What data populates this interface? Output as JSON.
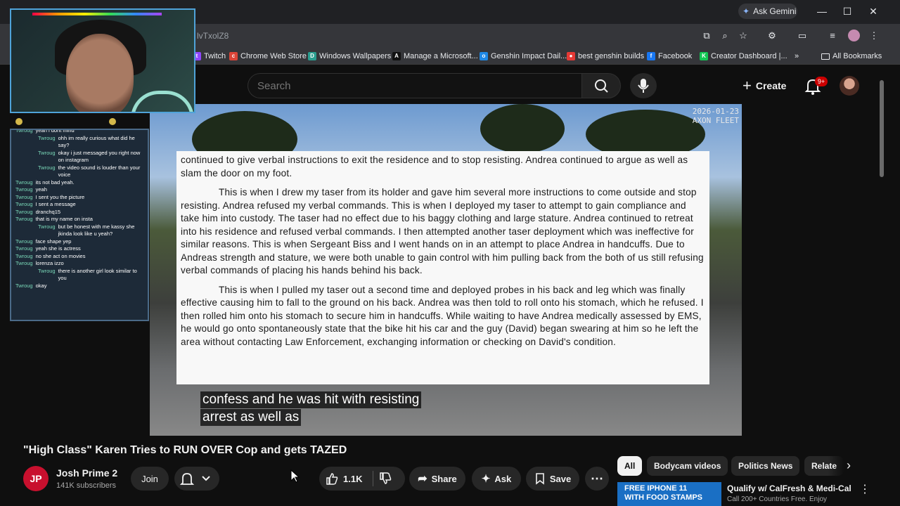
{
  "browser": {
    "ask_gemini": "Ask Gemini",
    "url_fragment": "lvTxolZ8",
    "bookmarks": [
      {
        "label": "Twitch",
        "color": "#9146ff",
        "glyph": "t"
      },
      {
        "label": "Chrome Web Store",
        "color": "#db4437",
        "glyph": "c"
      },
      {
        "label": "Windows Wallpapers",
        "color": "#2a9d8f",
        "glyph": "D"
      },
      {
        "label": "Manage a Microsoft...",
        "color": "#111111",
        "glyph": "A"
      },
      {
        "label": "Genshin Impact Dail...",
        "color": "#1e88e5",
        "glyph": "o"
      },
      {
        "label": "best genshin builds",
        "color": "#e53935",
        "glyph": "●"
      },
      {
        "label": "Facebook",
        "color": "#1877f2",
        "glyph": "f"
      },
      {
        "label": "Creator Dashboard |...",
        "color": "#12c754",
        "glyph": "K"
      }
    ],
    "all_bookmarks": "All Bookmarks",
    "overflow": "»"
  },
  "youtube": {
    "search_placeholder": "Search",
    "create_label": "Create",
    "notif_badge": "9+"
  },
  "video": {
    "camera_stamp_line1": "2026-01-23",
    "camera_stamp_line2": "AXON FLEET",
    "doc_paragraphs": [
      "continued to give verbal instructions to exit the residence and to stop resisting. Andrea continued to argue as well as slam the door on my foot.",
      "This is when I drew my taser from its holder and gave him several more instructions to come outside and stop resisting. Andrea refused my verbal commands. This is when I deployed my taser to attempt to gain compliance and take him into custody.  The taser had no effect due to his baggy clothing and large stature. Andrea continued to retreat into his residence and refused verbal commands. I then attempted another taser deployment  which was ineffective for similar reasons. This is when Sergeant Biss and I went hands on in an attempt to place Andrea in handcuffs. Due to Andreas strength and stature, we were both unable to gain control with him pulling back from the both of us still refusing verbal commands of placing his hands behind his back.",
      "This is when I pulled my taser out a second time and deployed probes in his back and leg which was finally effective causing him to fall to the ground on his back. Andrea was then told to roll onto his stomach, which he refused. I then rolled him onto his stomach to secure him in handcuffs. While waiting to have Andrea medically assessed by EMS, he would go onto spontaneously state that the bike hit his car and the guy (David) began swearing at him so he left the area without contacting Law Enforcement, exchanging information or checking on David's condition."
    ],
    "caption_line1": "confess and he was hit with resisting",
    "caption_line2": "arrest as well as"
  },
  "chat": [
    {
      "user": "Twroug",
      "msg": "yeah i dont mind",
      "indent": false
    },
    {
      "user": "Twroug",
      "msg": "ohh im really curious what did he say?",
      "indent": true
    },
    {
      "user": "Twroug",
      "msg": "okay i just messaged you right now on instagram",
      "indent": true
    },
    {
      "user": "Twroug",
      "msg": "the video sound is louder than your voice",
      "indent": true
    },
    {
      "user": "Twroug",
      "msg": "its not bad yeah.",
      "indent": false
    },
    {
      "user": "Twroug",
      "msg": "yeah",
      "indent": false
    },
    {
      "user": "Twroug",
      "msg": "I sent you the picture",
      "indent": false
    },
    {
      "user": "Twroug",
      "msg": "I sent a message",
      "indent": false
    },
    {
      "user": "Twroug",
      "msg": "dranchq15",
      "indent": false
    },
    {
      "user": "Twroug",
      "msg": "that is my name on insta",
      "indent": false
    },
    {
      "user": "Twroug",
      "msg": "but be honest with me kassy she jkinda look like u yeah?",
      "indent": true
    },
    {
      "user": "Twroug",
      "msg": "face shape yep",
      "indent": false
    },
    {
      "user": "Twroug",
      "msg": "yeah she is actress",
      "indent": false
    },
    {
      "user": "Twroug",
      "msg": "no she act on movies",
      "indent": false
    },
    {
      "user": "Twroug",
      "msg": "lorenza izzo",
      "indent": false
    },
    {
      "user": "Twroug",
      "msg": "there is another girl look similar to you",
      "indent": true
    },
    {
      "user": "Twroug",
      "msg": "okay",
      "indent": false
    }
  ],
  "details": {
    "title": "\"High Class\" Karen Tries to RUN OVER Cop and gets TAZED",
    "channel_name": "Josh Prime 2",
    "channel_subs": "141K subscribers",
    "channel_initials": "JP",
    "join": "Join",
    "likes": "1.1K",
    "share": "Share",
    "ask": "Ask",
    "save": "Save"
  },
  "chips": [
    "All",
    "Bodycam videos",
    "Politics News",
    "Relate"
  ],
  "ad": {
    "thumb_line1": "FREE IPHONE 11",
    "thumb_line2": "WITH FOOD STAMPS",
    "title": "Qualify w/ CalFresh & Medi-Cal",
    "sub": "Call 200+ Countries Free. Enjoy"
  }
}
